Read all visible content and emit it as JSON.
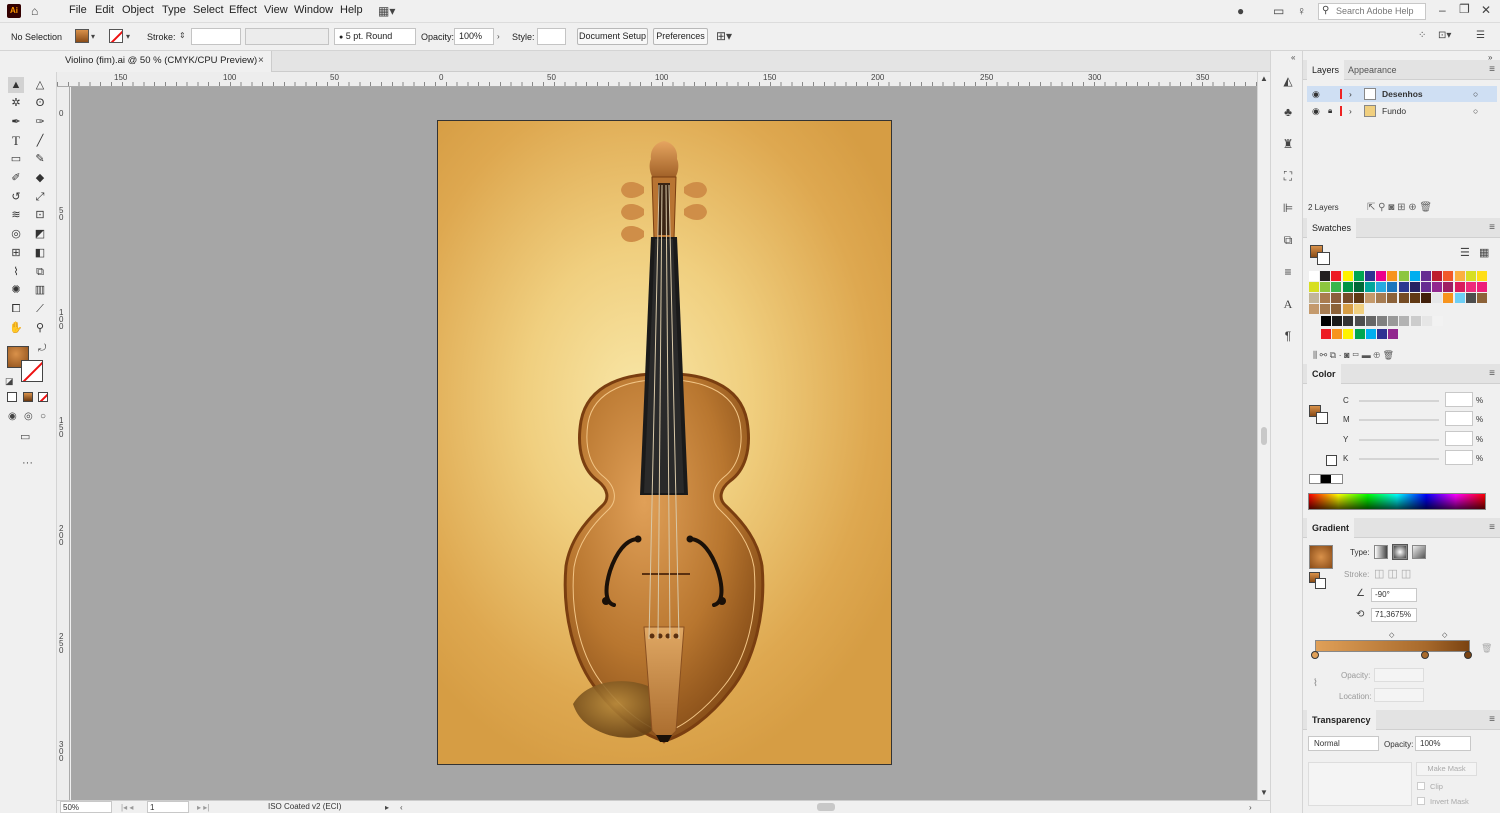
{
  "menu": {
    "app_logo": "Ai",
    "items": [
      "File",
      "Edit",
      "Object",
      "Type",
      "Select",
      "Effect",
      "View",
      "Window",
      "Help"
    ],
    "search_placeholder": "Search Adobe Help"
  },
  "control_bar": {
    "selection": "No Selection",
    "stroke_label": "Stroke:",
    "brush": "5 pt. Round",
    "opacity_label": "Opacity:",
    "opacity": "100%",
    "style_label": "Style:",
    "document_setup": "Document Setup",
    "preferences": "Preferences"
  },
  "document": {
    "tab_title": "Violino (fim).ai @ 50 % (CMYK/CPU Preview)",
    "close": "×"
  },
  "ruler": {
    "h_ticks": [
      "150",
      "100",
      "50",
      "0",
      "50",
      "100",
      "150",
      "200",
      "250",
      "300",
      "350"
    ],
    "v_ticks": [
      "0",
      "5 0",
      "1 0 0",
      "1 5 0",
      "2 0 0",
      "2 5 0",
      "3 0 0"
    ]
  },
  "status": {
    "zoom": "50%",
    "artboard": "1",
    "profile": "ISO Coated v2 (ECI)"
  },
  "layers_panel": {
    "tabs": [
      "Layers",
      "Appearance"
    ],
    "layers": [
      "Desenhos",
      "Fundo"
    ],
    "count": "2 Layers"
  },
  "swatches_panel": {
    "title": "Swatches",
    "colors_row1": [
      "#ffffff",
      "#231f20",
      "#ed1c24",
      "#fff200",
      "#00a651",
      "#2e3192",
      "#ec008c",
      "#f7941d",
      "#8dc63f",
      "#00aeef",
      "#662d91",
      "#be1e2d",
      "#f15a29",
      "#fbb040",
      "#d7df23",
      "#ffde17"
    ],
    "colors_row2": [
      "#d7df23",
      "#8dc63f",
      "#39b54a",
      "#009444",
      "#006838",
      "#00a79d",
      "#27aae1",
      "#1c75bc",
      "#2b3990",
      "#262262",
      "#662d91",
      "#92278f",
      "#9e1f63",
      "#da1c5c",
      "#ee2a7b",
      "#ed1e79"
    ],
    "colors_row3": [
      "#c2b59b",
      "#a97c50",
      "#8b5e3c",
      "#754c29",
      "#603913",
      "#c49a6c",
      "#a67c52",
      "#8c6239",
      "#754c24",
      "#603813",
      "#42210b",
      "#e6e7e8",
      "#f7941d",
      "#6dcff6",
      "#4d4d4d",
      "#8c6239"
    ],
    "colors_row4": [
      "#c49a6c",
      "#a67c52",
      "#8c6239",
      "#d69d44",
      "#f0cf7f"
    ],
    "grays": [
      "#000000",
      "#1a1a1a",
      "#333333",
      "#4d4d4d",
      "#666666",
      "#808080",
      "#999999",
      "#b3b3b3",
      "#cccccc",
      "#e6e6e6",
      "#f2f2f2"
    ],
    "brights": [
      "#ed1c24",
      "#f7941d",
      "#fff200",
      "#00a651",
      "#00aeef",
      "#2e3192",
      "#92278f"
    ]
  },
  "color_panel": {
    "title": "Color",
    "channels": [
      "C",
      "M",
      "Y",
      "K"
    ],
    "unit": "%"
  },
  "gradient_panel": {
    "title": "Gradient",
    "type_label": "Type:",
    "stroke_label": "Stroke:",
    "angle": "-90°",
    "aspect": "71,3675%",
    "opacity_label": "Opacity:",
    "location_label": "Location:",
    "stops": [
      "#e0a058",
      "#a86a2c",
      "#7a4312"
    ]
  },
  "transparency_panel": {
    "title": "Transparency",
    "mode": "Normal",
    "opacity_label": "Opacity:",
    "opacity": "100%",
    "make_mask": "Make Mask",
    "clip": "Clip",
    "invert_mask": "Invert Mask"
  }
}
